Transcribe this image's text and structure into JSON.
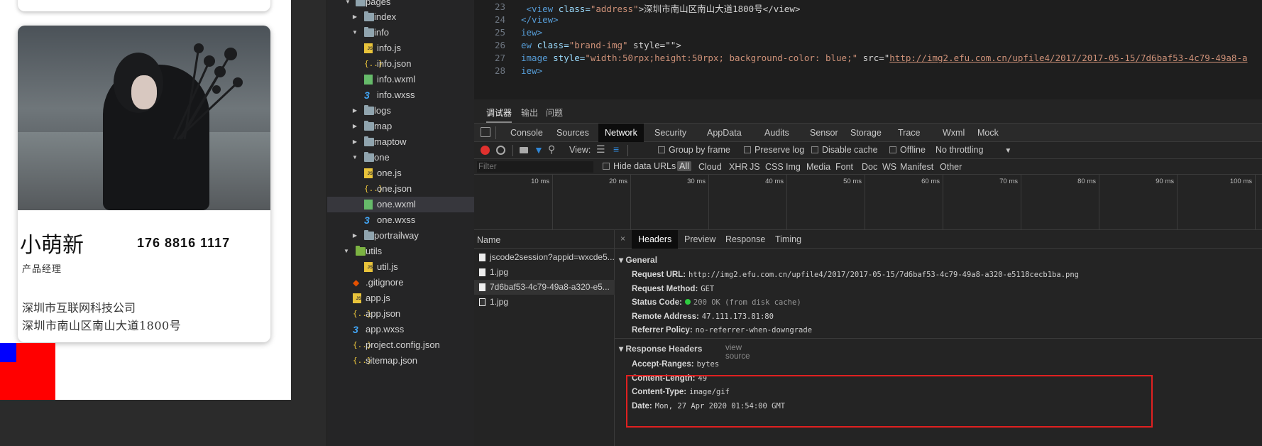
{
  "simulator": {
    "name": "小萌新",
    "phone": "176 8816 1117",
    "job_title": "产品经理",
    "company": "深圳市互联网科技公司",
    "address": "深圳市南山区南山大道1800号"
  },
  "file_tree": {
    "items": [
      {
        "label": "pages",
        "type": "folder",
        "expanded": true
      },
      {
        "label": "index",
        "type": "folder",
        "expanded": false
      },
      {
        "label": "info",
        "type": "folder",
        "expanded": true
      },
      {
        "label": "info.js",
        "type": "js"
      },
      {
        "label": "info.json",
        "type": "json"
      },
      {
        "label": "info.wxml",
        "type": "wxml"
      },
      {
        "label": "info.wxss",
        "type": "wxss"
      },
      {
        "label": "logs",
        "type": "folder",
        "expanded": false
      },
      {
        "label": "map",
        "type": "folder",
        "expanded": false
      },
      {
        "label": "maptow",
        "type": "folder",
        "expanded": false
      },
      {
        "label": "one",
        "type": "folder",
        "expanded": true
      },
      {
        "label": "one.js",
        "type": "js"
      },
      {
        "label": "one.json",
        "type": "json"
      },
      {
        "label": "one.wxml",
        "type": "wxml",
        "selected": true
      },
      {
        "label": "one.wxss",
        "type": "wxss"
      },
      {
        "label": "portrailway",
        "type": "folder",
        "expanded": false
      },
      {
        "label": "utils",
        "type": "folder",
        "expanded": true
      },
      {
        "label": "util.js",
        "type": "js"
      },
      {
        "label": ".gitignore",
        "type": "git"
      },
      {
        "label": "app.js",
        "type": "js"
      },
      {
        "label": "app.json",
        "type": "json"
      },
      {
        "label": "app.wxss",
        "type": "wxss"
      },
      {
        "label": "project.config.json",
        "type": "json"
      },
      {
        "label": "sitemap.json",
        "type": "json"
      }
    ]
  },
  "editor": {
    "line_numbers": [
      "23",
      "24",
      "25",
      "26",
      "27",
      "28"
    ],
    "lines": [
      {
        "a": " <view ",
        "b": "class=",
        "c": "\"address\"",
        "d": ">深圳市南山区南山大道1800号</view>"
      },
      {
        "a": "</view>",
        "b": "",
        "c": "",
        "d": ""
      },
      {
        "a": "iew>",
        "b": "",
        "c": "",
        "d": ""
      },
      {
        "a": "ew ",
        "b": "class=",
        "c": "\"brand-img\"",
        "d": " style=\"\">"
      },
      {
        "a": "image ",
        "b": "style=",
        "c": "\"width:50rpx;height:50rpx; background-color: blue;\"",
        "d": " src=\"",
        "link": "http://img2.efu.com.cn/upfile4/2017/2017-05-15/7d6baf53-4c79-49a8-a"
      },
      {
        "a": "iew>",
        "b": "",
        "c": "",
        "d": ""
      }
    ]
  },
  "devtools": {
    "top_tabs": [
      "调试器",
      "输出",
      "问题"
    ],
    "panel_tabs": [
      "Console",
      "Sources",
      "Network",
      "Security",
      "AppData",
      "Audits",
      "Sensor",
      "Storage",
      "Trace",
      "Wxml",
      "Mock"
    ],
    "active_panel": "Network",
    "toolbar": {
      "view_label": "View:",
      "group_by_frame": "Group by frame",
      "preserve_log": "Preserve log",
      "disable_cache": "Disable cache",
      "offline": "Offline",
      "throttling": "No throttling"
    },
    "filter": {
      "placeholder": "Filter",
      "hide_data_urls": "Hide data URLs",
      "types": [
        "All",
        "Cloud",
        "XHR",
        "JS",
        "CSS",
        "Img",
        "Media",
        "Font",
        "Doc",
        "WS",
        "Manifest",
        "Other"
      ]
    },
    "timeline_ticks": [
      "10 ms",
      "20 ms",
      "30 ms",
      "40 ms",
      "50 ms",
      "60 ms",
      "70 ms",
      "80 ms",
      "90 ms",
      "100 ms"
    ],
    "requests": {
      "header": "Name",
      "rows": [
        "jscode2session?appid=wxcde5...",
        "1.jpg",
        "7d6baf53-4c79-49a8-a320-e5...",
        "1.jpg"
      ]
    },
    "detail": {
      "tabs": [
        "Headers",
        "Preview",
        "Response",
        "Timing"
      ],
      "close": "×",
      "general_title": "▾ General",
      "general": [
        {
          "key": "Request URL:",
          "value": "http://img2.efu.com.cn/upfile4/2017/2017-05-15/7d6baf53-4c79-49a8-a320-e5118cecb1ba.png"
        },
        {
          "key": "Request Method:",
          "value": "GET"
        },
        {
          "key": "Status Code:",
          "value": "200 OK (from disk cache)"
        },
        {
          "key": "Remote Address:",
          "value": "47.111.173.81:80"
        },
        {
          "key": "Referrer Policy:",
          "value": "no-referrer-when-downgrade"
        }
      ],
      "response_headers_title": "▾ Response Headers",
      "view_source": "view source",
      "response_headers": [
        {
          "key": "Accept-Ranges:",
          "value": "bytes"
        },
        {
          "key": "Content-Length:",
          "value": "49"
        },
        {
          "key": "Content-Type:",
          "value": "image/gif"
        },
        {
          "key": "Date:",
          "value": "Mon, 27 Apr 2020 01:54:00 GMT"
        }
      ]
    }
  },
  "colors": {
    "status_ok": "#2ecc40",
    "highlight_border": "#e02020",
    "red_block": "#ff0000",
    "blue_block": "#0000ff"
  }
}
